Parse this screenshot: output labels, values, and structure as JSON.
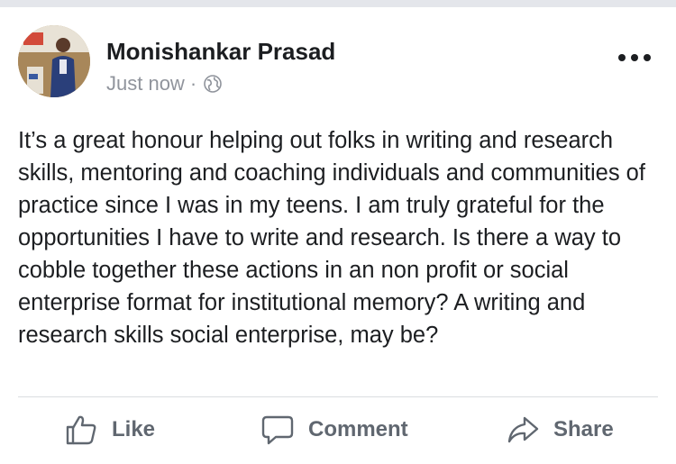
{
  "post": {
    "author": "Monishankar Prasad",
    "timestamp": "Just now",
    "separator": "·",
    "privacy_icon": "globe-icon",
    "menu_icon": "more-options-icon",
    "text": "It’s a great honour helping out folks in writing and research skills, mentoring and coaching individuals and communities of practice since I was in my teens. I am truly grateful for the opportunities I have to write and research. Is there a way to cobble together these actions in an non profit or social enterprise format for institutional memory? A writing and research skills social enterprise, may be?"
  },
  "actions": {
    "like": {
      "label": "Like",
      "icon": "thumbs-up-icon"
    },
    "comment": {
      "label": "Comment",
      "icon": "speech-bubble-icon"
    },
    "share": {
      "label": "Share",
      "icon": "share-arrow-icon"
    }
  },
  "colors": {
    "text": "#1c1e21",
    "meta": "#90949c",
    "action": "#606770",
    "divider": "#dadde1"
  }
}
